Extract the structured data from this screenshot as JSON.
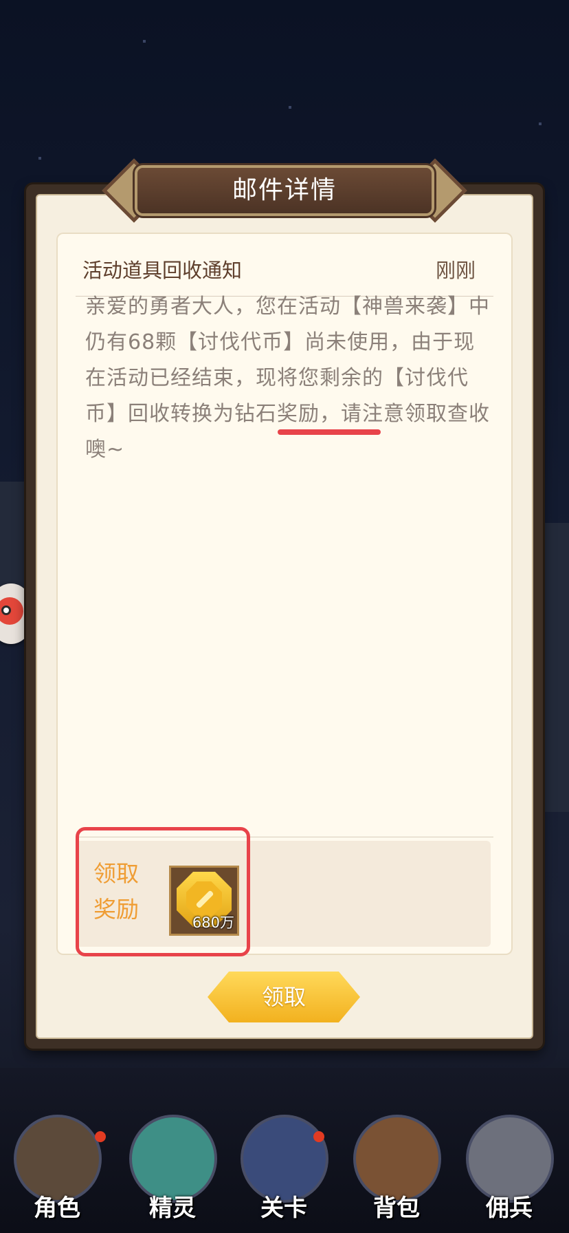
{
  "mail": {
    "window_title": "邮件详情",
    "subject": "活动道具回收通知",
    "time": "刚刚",
    "body": "亲爱的勇者大人，您在活动【神兽来袭】中仍有68颗【讨伐代币】尚未使用，由于现在活动已经结束，现将您剩余的【讨伐代币】回收转换为钻石奖励，请注意领取查收噢~",
    "reward_label": "领取奖励",
    "reward_item": {
      "icon": "gold-sword-coin-icon",
      "count": "680万"
    },
    "claim_button": "领取"
  },
  "nav": {
    "items": [
      {
        "label": "角色",
        "icon": "character-icon"
      },
      {
        "label": "精灵",
        "icon": "spirit-icon"
      },
      {
        "label": "关卡",
        "icon": "stage-icon"
      },
      {
        "label": "背包",
        "icon": "backpack-icon"
      },
      {
        "label": "佣兵",
        "icon": "mercenary-icon"
      }
    ]
  },
  "colors": {
    "accent_orange": "#ef9d34",
    "button_gold": "#f2b11f",
    "annotation_red": "#e8434a"
  }
}
